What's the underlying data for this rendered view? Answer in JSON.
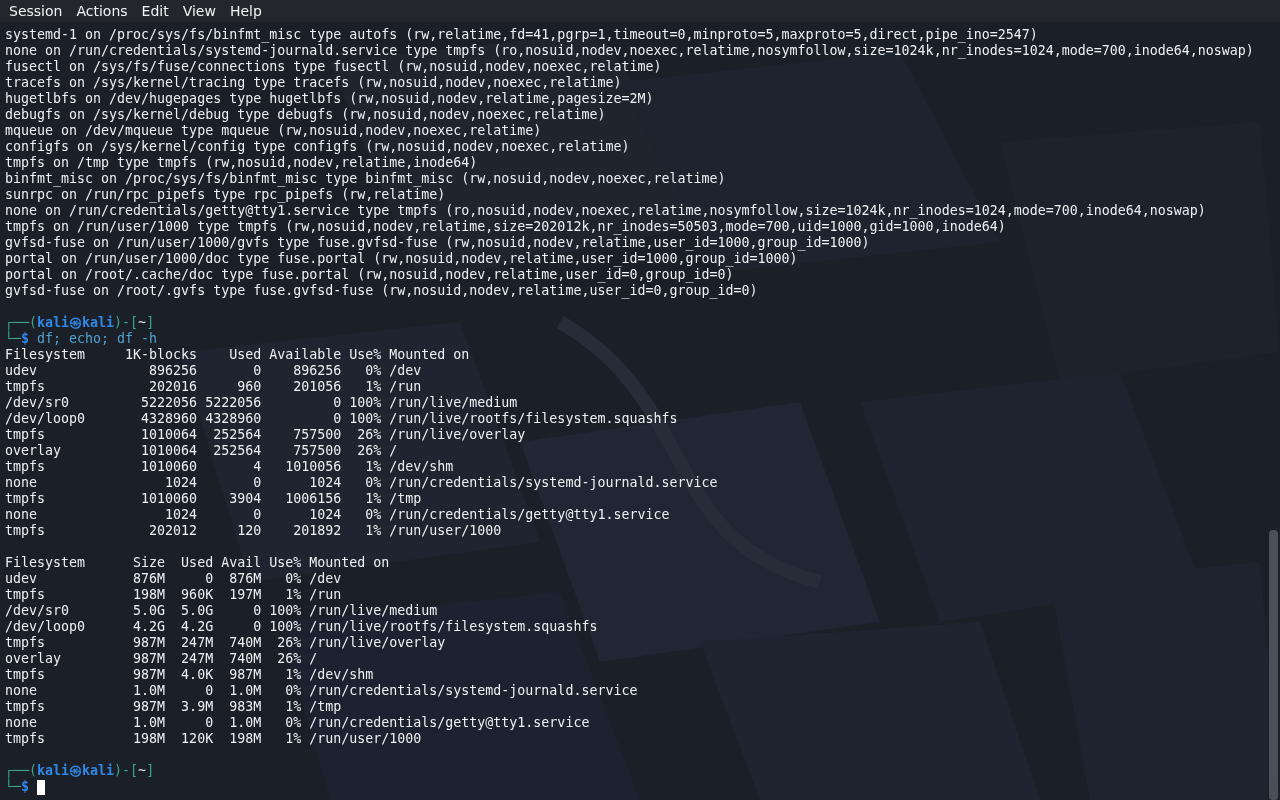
{
  "menu": [
    {
      "label": "Session"
    },
    {
      "label": "Actions"
    },
    {
      "label": "Edit"
    },
    {
      "label": "View"
    },
    {
      "label": "Help"
    }
  ],
  "lines": [
    {
      "kind": "output",
      "text": "systemd-1 on /proc/sys/fs/binfmt_misc type autofs (rw,relatime,fd=41,pgrp=1,timeout=0,minproto=5,maxproto=5,direct,pipe_ino=2547)"
    },
    {
      "kind": "output",
      "text": "none on /run/credentials/systemd-journald.service type tmpfs (ro,nosuid,nodev,noexec,relatime,nosymfollow,size=1024k,nr_inodes=1024,mode=700,inode64,noswap)"
    },
    {
      "kind": "output",
      "text": "fusectl on /sys/fs/fuse/connections type fusectl (rw,nosuid,nodev,noexec,relatime)"
    },
    {
      "kind": "output",
      "text": "tracefs on /sys/kernel/tracing type tracefs (rw,nosuid,nodev,noexec,relatime)"
    },
    {
      "kind": "output",
      "text": "hugetlbfs on /dev/hugepages type hugetlbfs (rw,nosuid,nodev,relatime,pagesize=2M)"
    },
    {
      "kind": "output",
      "text": "debugfs on /sys/kernel/debug type debugfs (rw,nosuid,nodev,noexec,relatime)"
    },
    {
      "kind": "output",
      "text": "mqueue on /dev/mqueue type mqueue (rw,nosuid,nodev,noexec,relatime)"
    },
    {
      "kind": "output",
      "text": "configfs on /sys/kernel/config type configfs (rw,nosuid,nodev,noexec,relatime)"
    },
    {
      "kind": "output",
      "text": "tmpfs on /tmp type tmpfs (rw,nosuid,nodev,relatime,inode64)"
    },
    {
      "kind": "output",
      "text": "binfmt_misc on /proc/sys/fs/binfmt_misc type binfmt_misc (rw,nosuid,nodev,noexec,relatime)"
    },
    {
      "kind": "output",
      "text": "sunrpc on /run/rpc_pipefs type rpc_pipefs (rw,relatime)"
    },
    {
      "kind": "output",
      "text": "none on /run/credentials/getty@tty1.service type tmpfs (ro,nosuid,nodev,noexec,relatime,nosymfollow,size=1024k,nr_inodes=1024,mode=700,inode64,noswap)"
    },
    {
      "kind": "output",
      "text": "tmpfs on /run/user/1000 type tmpfs (rw,nosuid,nodev,relatime,size=202012k,nr_inodes=50503,mode=700,uid=1000,gid=1000,inode64)"
    },
    {
      "kind": "output",
      "text": "gvfsd-fuse on /run/user/1000/gvfs type fuse.gvfsd-fuse (rw,nosuid,nodev,relatime,user_id=1000,group_id=1000)"
    },
    {
      "kind": "output",
      "text": "portal on /run/user/1000/doc type fuse.portal (rw,nosuid,nodev,relatime,user_id=1000,group_id=1000)"
    },
    {
      "kind": "output",
      "text": "portal on /root/.cache/doc type fuse.portal (rw,nosuid,nodev,relatime,user_id=0,group_id=0)"
    },
    {
      "kind": "output",
      "text": "gvfsd-fuse on /root/.gvfs type fuse.gvfsd-fuse (rw,nosuid,nodev,relatime,user_id=0,group_id=0)"
    },
    {
      "kind": "blank"
    },
    {
      "kind": "prompt",
      "top": [
        {
          "kind": "frame",
          "text": "┌──("
        },
        {
          "kind": "user",
          "text": "kali㉿kali"
        },
        {
          "kind": "frame",
          "text": ")-["
        },
        {
          "kind": "dir",
          "text": "~"
        },
        {
          "kind": "frame",
          "text": "]"
        }
      ],
      "bottom": [
        {
          "kind": "frame",
          "text": "└─"
        },
        {
          "kind": "symbol",
          "text": "$"
        }
      ],
      "command": "df; echo; df -h",
      "cursor": false
    },
    {
      "kind": "output",
      "text": "Filesystem     1K-blocks    Used Available Use% Mounted on"
    },
    {
      "kind": "output",
      "text": "udev              896256       0    896256   0% /dev"
    },
    {
      "kind": "output",
      "text": "tmpfs             202016     960    201056   1% /run"
    },
    {
      "kind": "output",
      "text": "/dev/sr0         5222056 5222056         0 100% /run/live/medium"
    },
    {
      "kind": "output",
      "text": "/dev/loop0       4328960 4328960         0 100% /run/live/rootfs/filesystem.squashfs"
    },
    {
      "kind": "output",
      "text": "tmpfs            1010064  252564    757500  26% /run/live/overlay"
    },
    {
      "kind": "output",
      "text": "overlay          1010064  252564    757500  26% /"
    },
    {
      "kind": "output",
      "text": "tmpfs            1010060       4   1010056   1% /dev/shm"
    },
    {
      "kind": "output",
      "text": "none                1024       0      1024   0% /run/credentials/systemd-journald.service"
    },
    {
      "kind": "output",
      "text": "tmpfs            1010060    3904   1006156   1% /tmp"
    },
    {
      "kind": "output",
      "text": "none                1024       0      1024   0% /run/credentials/getty@tty1.service"
    },
    {
      "kind": "output",
      "text": "tmpfs             202012     120    201892   1% /run/user/1000"
    },
    {
      "kind": "blank"
    },
    {
      "kind": "output",
      "text": "Filesystem      Size  Used Avail Use% Mounted on"
    },
    {
      "kind": "output",
      "text": "udev            876M     0  876M   0% /dev"
    },
    {
      "kind": "output",
      "text": "tmpfs           198M  960K  197M   1% /run"
    },
    {
      "kind": "output",
      "text": "/dev/sr0        5.0G  5.0G     0 100% /run/live/medium"
    },
    {
      "kind": "output",
      "text": "/dev/loop0      4.2G  4.2G     0 100% /run/live/rootfs/filesystem.squashfs"
    },
    {
      "kind": "output",
      "text": "tmpfs           987M  247M  740M  26% /run/live/overlay"
    },
    {
      "kind": "output",
      "text": "overlay         987M  247M  740M  26% /"
    },
    {
      "kind": "output",
      "text": "tmpfs           987M  4.0K  987M   1% /dev/shm"
    },
    {
      "kind": "output",
      "text": "none            1.0M     0  1.0M   0% /run/credentials/systemd-journald.service"
    },
    {
      "kind": "output",
      "text": "tmpfs           987M  3.9M  983M   1% /tmp"
    },
    {
      "kind": "output",
      "text": "none            1.0M     0  1.0M   0% /run/credentials/getty@tty1.service"
    },
    {
      "kind": "output",
      "text": "tmpfs           198M  120K  198M   1% /run/user/1000"
    },
    {
      "kind": "blank"
    },
    {
      "kind": "prompt",
      "top": [
        {
          "kind": "frame",
          "text": "┌──("
        },
        {
          "kind": "user",
          "text": "kali㉿kali"
        },
        {
          "kind": "frame",
          "text": ")-["
        },
        {
          "kind": "dir",
          "text": "~"
        },
        {
          "kind": "frame",
          "text": "]"
        }
      ],
      "bottom": [
        {
          "kind": "frame",
          "text": "└─"
        },
        {
          "kind": "symbol",
          "text": "$"
        }
      ],
      "cursor": true
    }
  ]
}
